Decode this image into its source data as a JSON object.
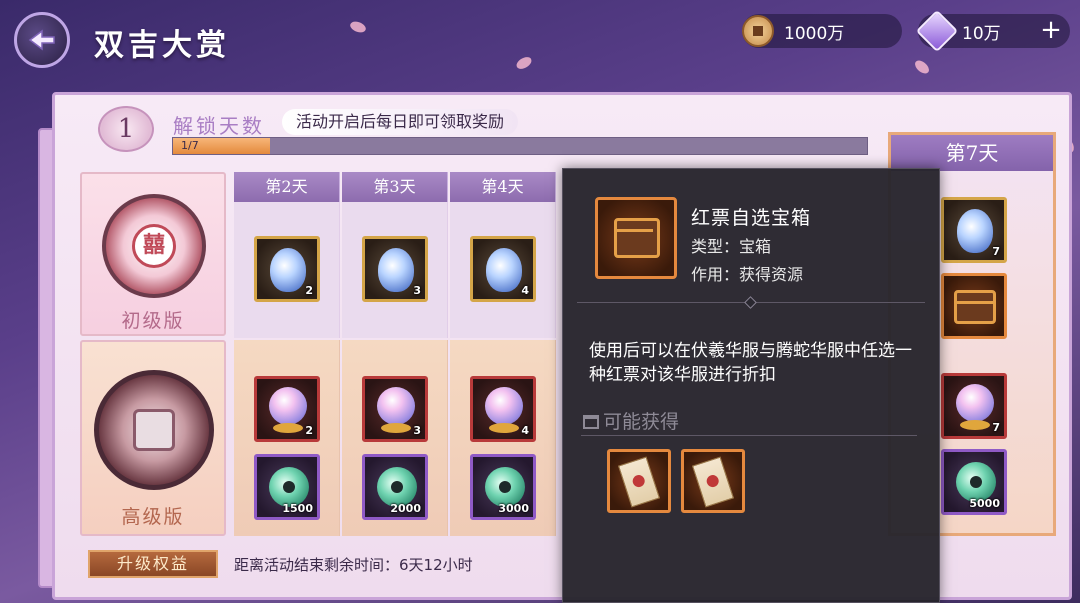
{
  "header": {
    "title": "双吉大赏",
    "coins": "1000万",
    "gems": "10万",
    "plus_label": "+"
  },
  "unlock": {
    "day_number": "1",
    "label": "解锁天数",
    "description": "活动开启后每日即可领取奖励",
    "progress_text": "1/7",
    "progress": 0.14
  },
  "tiers": {
    "basic_label": "初级版",
    "basic_emblem_glyph": "囍",
    "advanced_label": "高级版"
  },
  "days": [
    {
      "label": "第2天",
      "basic_count": "2",
      "adv_orb_count": "2",
      "adv_jade_count": "1500"
    },
    {
      "label": "第3天",
      "basic_count": "3",
      "adv_orb_count": "3",
      "adv_jade_count": "2000"
    },
    {
      "label": "第4天",
      "basic_count": "4",
      "adv_orb_count": "4",
      "adv_jade_count": "3000"
    }
  ],
  "day7": {
    "label": "第7天",
    "basic_count": "7",
    "adv_orb_count": "7",
    "adv_jade_count": "5000"
  },
  "tooltip": {
    "name": "红票自选宝箱",
    "type": "类型：宝箱",
    "use": "作用：获得资源",
    "description": "使用后可以在伏羲华服与腾蛇华服中任选一种红票对该华服进行折扣",
    "possible_label": "可能获得"
  },
  "footer": {
    "upgrade_label": "升级权益",
    "countdown": "距离活动结束剩余时间：6天12小时"
  }
}
